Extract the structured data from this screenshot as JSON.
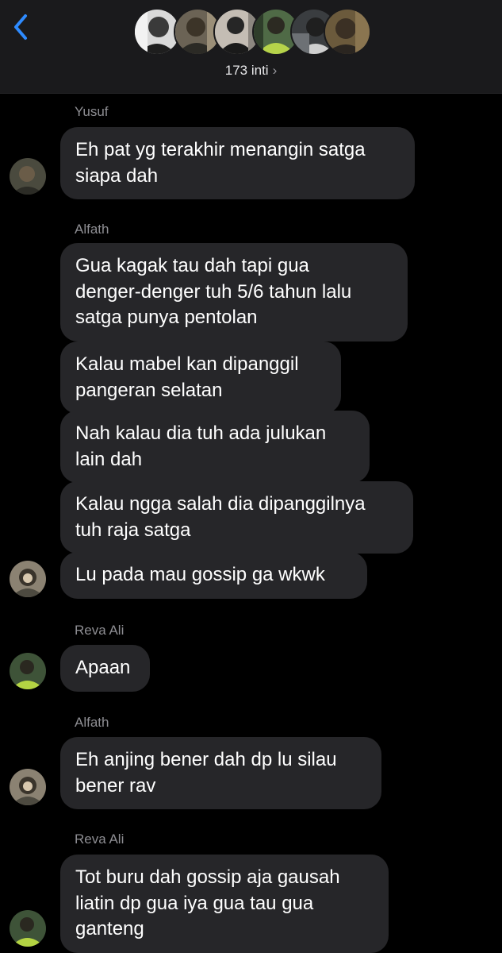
{
  "header": {
    "member_count": "173 inti",
    "chevron": "›",
    "back_icon": "chevron-left-icon",
    "accent_color": "#2e8bff"
  },
  "messages": [
    {
      "sender": "Yusuf",
      "text": "Eh pat yg terakhir menangin satga\nsiapa dah"
    },
    {
      "sender": "Alfath",
      "text": "Gua kagak tau dah tapi gua\ndenger-denger tuh 5/6 tahun lalu\nsatga punya pentolan"
    },
    {
      "sender": "",
      "text": "Kalau mabel kan dipanggil\npangeran selatan"
    },
    {
      "sender": "",
      "text": "Nah kalau dia tuh ada julukan\nlain dah"
    },
    {
      "sender": "",
      "text": "Kalau ngga salah dia dipanggilnya\ntuh raja satga"
    },
    {
      "sender": "",
      "text": "Lu pada mau gossip ga wkwk"
    },
    {
      "sender": "Reva Ali",
      "text": "Apaan"
    },
    {
      "sender": "Alfath",
      "text": "Eh anjing bener dah dp lu silau\nbener rav"
    },
    {
      "sender": "Reva Ali",
      "text": "Tot buru dah gossip aja gausah\nliatin dp gua iya gua tau gua\nganteng"
    }
  ]
}
